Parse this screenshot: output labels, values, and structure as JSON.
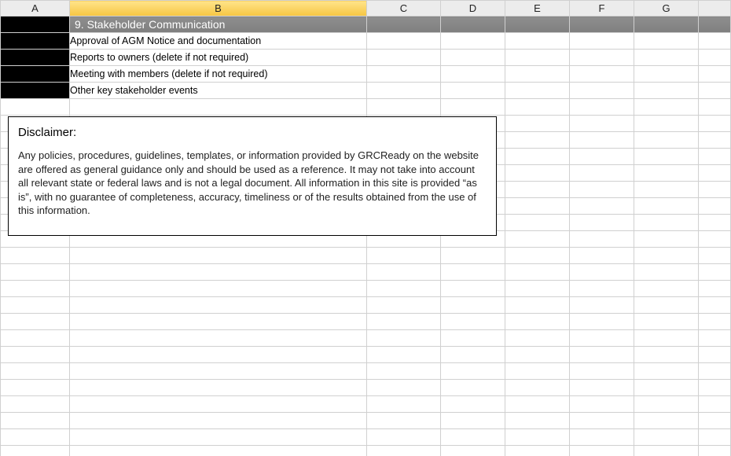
{
  "columns": {
    "A": "A",
    "B": "B",
    "C": "C",
    "D": "D",
    "E": "E",
    "F": "F",
    "G": "G"
  },
  "section": {
    "title": "9. Stakeholder Communication"
  },
  "rows": {
    "r1": "Approval of AGM Notice and documentation",
    "r2": "Reports to owners (delete if not required)",
    "r3": "Meeting with members (delete if not required)",
    "r4": "Other key stakeholder events"
  },
  "disclaimer": {
    "title": "Disclaimer:",
    "body": "Any policies, procedures, guidelines, templates, or information provided by GRCReady on the website are offered as general guidance only and should be used as a reference. It may not take into account all relevant state or federal laws and is not a legal document. All information in this site is provided “as is”, with no guarantee of completeness, accuracy, timeliness or of the results obtained from the use of this information."
  }
}
